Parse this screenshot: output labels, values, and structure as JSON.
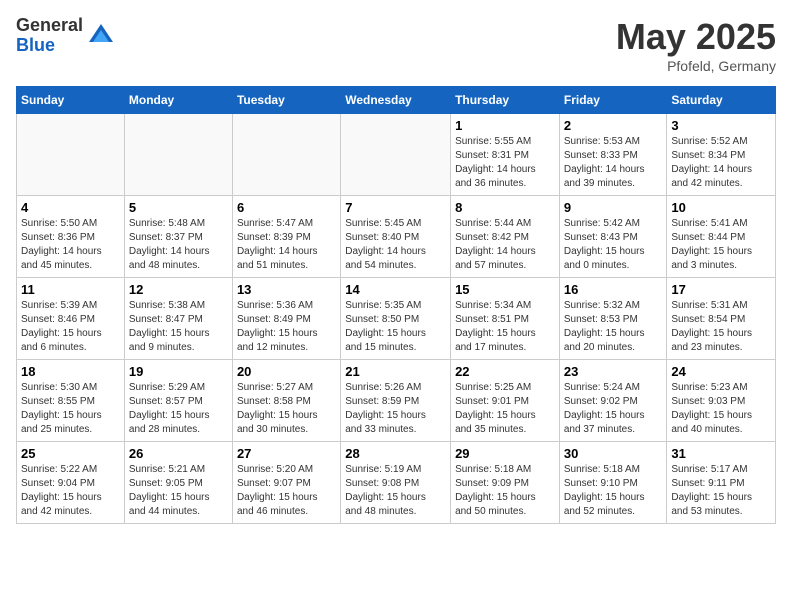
{
  "logo": {
    "general": "General",
    "blue": "Blue"
  },
  "title": "May 2025",
  "location": "Pfofeld, Germany",
  "weekdays": [
    "Sunday",
    "Monday",
    "Tuesday",
    "Wednesday",
    "Thursday",
    "Friday",
    "Saturday"
  ],
  "weeks": [
    [
      {
        "day": "",
        "info": ""
      },
      {
        "day": "",
        "info": ""
      },
      {
        "day": "",
        "info": ""
      },
      {
        "day": "",
        "info": ""
      },
      {
        "day": "1",
        "info": "Sunrise: 5:55 AM\nSunset: 8:31 PM\nDaylight: 14 hours\nand 36 minutes."
      },
      {
        "day": "2",
        "info": "Sunrise: 5:53 AM\nSunset: 8:33 PM\nDaylight: 14 hours\nand 39 minutes."
      },
      {
        "day": "3",
        "info": "Sunrise: 5:52 AM\nSunset: 8:34 PM\nDaylight: 14 hours\nand 42 minutes."
      }
    ],
    [
      {
        "day": "4",
        "info": "Sunrise: 5:50 AM\nSunset: 8:36 PM\nDaylight: 14 hours\nand 45 minutes."
      },
      {
        "day": "5",
        "info": "Sunrise: 5:48 AM\nSunset: 8:37 PM\nDaylight: 14 hours\nand 48 minutes."
      },
      {
        "day": "6",
        "info": "Sunrise: 5:47 AM\nSunset: 8:39 PM\nDaylight: 14 hours\nand 51 minutes."
      },
      {
        "day": "7",
        "info": "Sunrise: 5:45 AM\nSunset: 8:40 PM\nDaylight: 14 hours\nand 54 minutes."
      },
      {
        "day": "8",
        "info": "Sunrise: 5:44 AM\nSunset: 8:42 PM\nDaylight: 14 hours\nand 57 minutes."
      },
      {
        "day": "9",
        "info": "Sunrise: 5:42 AM\nSunset: 8:43 PM\nDaylight: 15 hours\nand 0 minutes."
      },
      {
        "day": "10",
        "info": "Sunrise: 5:41 AM\nSunset: 8:44 PM\nDaylight: 15 hours\nand 3 minutes."
      }
    ],
    [
      {
        "day": "11",
        "info": "Sunrise: 5:39 AM\nSunset: 8:46 PM\nDaylight: 15 hours\nand 6 minutes."
      },
      {
        "day": "12",
        "info": "Sunrise: 5:38 AM\nSunset: 8:47 PM\nDaylight: 15 hours\nand 9 minutes."
      },
      {
        "day": "13",
        "info": "Sunrise: 5:36 AM\nSunset: 8:49 PM\nDaylight: 15 hours\nand 12 minutes."
      },
      {
        "day": "14",
        "info": "Sunrise: 5:35 AM\nSunset: 8:50 PM\nDaylight: 15 hours\nand 15 minutes."
      },
      {
        "day": "15",
        "info": "Sunrise: 5:34 AM\nSunset: 8:51 PM\nDaylight: 15 hours\nand 17 minutes."
      },
      {
        "day": "16",
        "info": "Sunrise: 5:32 AM\nSunset: 8:53 PM\nDaylight: 15 hours\nand 20 minutes."
      },
      {
        "day": "17",
        "info": "Sunrise: 5:31 AM\nSunset: 8:54 PM\nDaylight: 15 hours\nand 23 minutes."
      }
    ],
    [
      {
        "day": "18",
        "info": "Sunrise: 5:30 AM\nSunset: 8:55 PM\nDaylight: 15 hours\nand 25 minutes."
      },
      {
        "day": "19",
        "info": "Sunrise: 5:29 AM\nSunset: 8:57 PM\nDaylight: 15 hours\nand 28 minutes."
      },
      {
        "day": "20",
        "info": "Sunrise: 5:27 AM\nSunset: 8:58 PM\nDaylight: 15 hours\nand 30 minutes."
      },
      {
        "day": "21",
        "info": "Sunrise: 5:26 AM\nSunset: 8:59 PM\nDaylight: 15 hours\nand 33 minutes."
      },
      {
        "day": "22",
        "info": "Sunrise: 5:25 AM\nSunset: 9:01 PM\nDaylight: 15 hours\nand 35 minutes."
      },
      {
        "day": "23",
        "info": "Sunrise: 5:24 AM\nSunset: 9:02 PM\nDaylight: 15 hours\nand 37 minutes."
      },
      {
        "day": "24",
        "info": "Sunrise: 5:23 AM\nSunset: 9:03 PM\nDaylight: 15 hours\nand 40 minutes."
      }
    ],
    [
      {
        "day": "25",
        "info": "Sunrise: 5:22 AM\nSunset: 9:04 PM\nDaylight: 15 hours\nand 42 minutes."
      },
      {
        "day": "26",
        "info": "Sunrise: 5:21 AM\nSunset: 9:05 PM\nDaylight: 15 hours\nand 44 minutes."
      },
      {
        "day": "27",
        "info": "Sunrise: 5:20 AM\nSunset: 9:07 PM\nDaylight: 15 hours\nand 46 minutes."
      },
      {
        "day": "28",
        "info": "Sunrise: 5:19 AM\nSunset: 9:08 PM\nDaylight: 15 hours\nand 48 minutes."
      },
      {
        "day": "29",
        "info": "Sunrise: 5:18 AM\nSunset: 9:09 PM\nDaylight: 15 hours\nand 50 minutes."
      },
      {
        "day": "30",
        "info": "Sunrise: 5:18 AM\nSunset: 9:10 PM\nDaylight: 15 hours\nand 52 minutes."
      },
      {
        "day": "31",
        "info": "Sunrise: 5:17 AM\nSunset: 9:11 PM\nDaylight: 15 hours\nand 53 minutes."
      }
    ]
  ]
}
